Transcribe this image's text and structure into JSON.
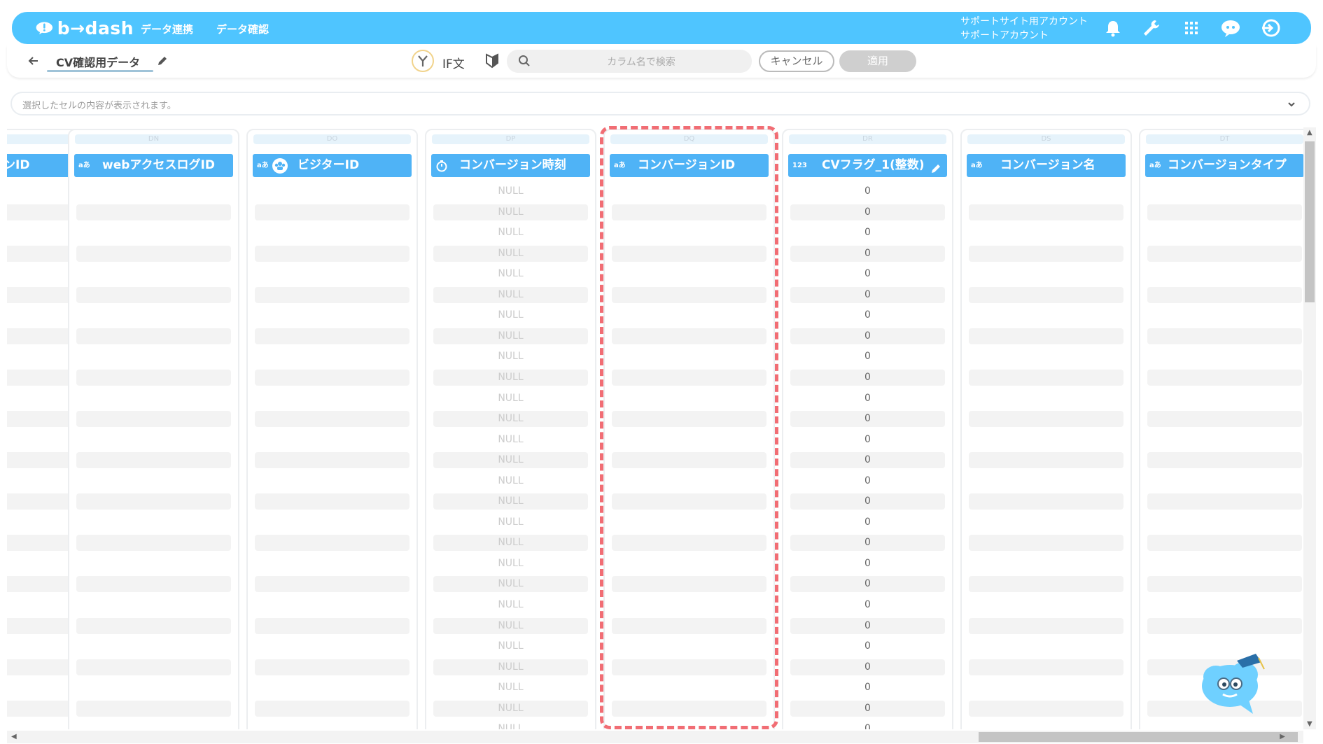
{
  "header": {
    "logo_text": "b→dash",
    "nav": [
      "データ連携",
      "データ確認"
    ],
    "account_line1": "サポートサイト用アカウント",
    "account_line2": "サポートアカウント",
    "icons": [
      "bell-icon",
      "wrench-icon",
      "apps-grid-icon",
      "chat-icon",
      "logout-icon"
    ]
  },
  "toolbar": {
    "title": "CV確認用データ",
    "if_label": "IF文",
    "search_placeholder": "カラム名で検索",
    "cancel_label": "キャンセル",
    "apply_label": "適用"
  },
  "cellbar": {
    "placeholder": "選択したセルの内容が表示されます。"
  },
  "grid": {
    "columns": [
      {
        "letter": "",
        "type": "",
        "label": "ンID",
        "kind": "blank"
      },
      {
        "letter": "DN",
        "type": "aあ",
        "label": "webアクセスログID",
        "kind": "blank"
      },
      {
        "letter": "DO",
        "type": "aあ",
        "label": "ビジターID",
        "kind": "blank"
      },
      {
        "letter": "DP",
        "type": "clock",
        "label": "コンバージョン時刻",
        "kind": "null"
      },
      {
        "letter": "DQ",
        "type": "aあ",
        "label": "コンバージョンID",
        "kind": "blank"
      },
      {
        "letter": "DR",
        "type": "123",
        "label": "CVフラグ_1(整数)",
        "kind": "zero"
      },
      {
        "letter": "DS",
        "type": "aあ",
        "label": "コンバージョン名",
        "kind": "blank"
      },
      {
        "letter": "DT",
        "type": "aあ",
        "label": "コンバージョンタイプ",
        "kind": "blank"
      }
    ],
    "null_text": "NULL",
    "zero_text": "0",
    "row_count": 27
  },
  "colors": {
    "accent": "#4fc5ff",
    "header_cell": "#4fb3f6",
    "highlight": "#f16d74"
  }
}
